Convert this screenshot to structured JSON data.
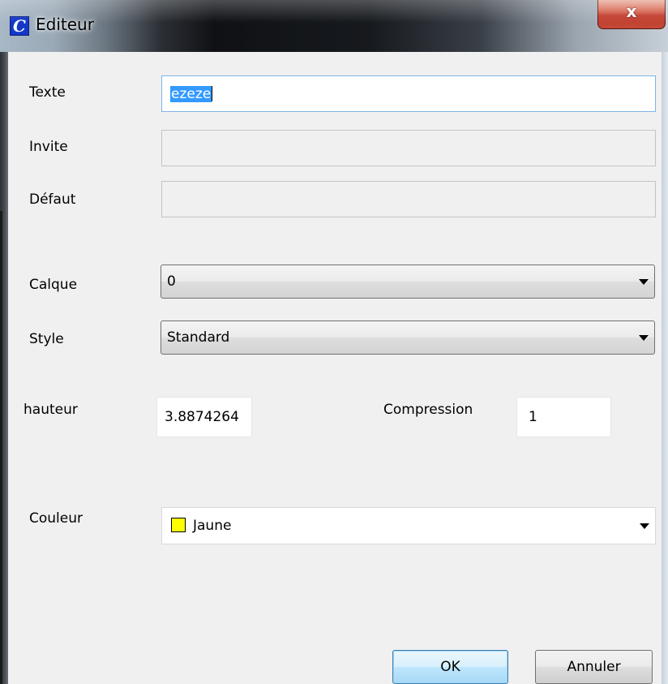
{
  "window": {
    "title": "Editeur",
    "app_icon_glyph": "C",
    "close_glyph": "x"
  },
  "form": {
    "texte": {
      "label": "Texte",
      "value": "ezeze"
    },
    "invite": {
      "label": "Invite",
      "value": ""
    },
    "defaut": {
      "label": "Défaut",
      "value": ""
    },
    "calque": {
      "label": "Calque",
      "value": "0"
    },
    "style": {
      "label": "Style",
      "value": "Standard"
    },
    "hauteur": {
      "label": "hauteur",
      "value": "3.8874264"
    },
    "compression": {
      "label": "Compression",
      "value": "1"
    },
    "couleur": {
      "label": "Couleur",
      "value": "Jaune",
      "swatch_color": "#ffff00"
    }
  },
  "buttons": {
    "ok": "OK",
    "annuler": "Annuler"
  },
  "icons": {
    "app": "app-logo-icon",
    "close": "close-icon",
    "dropdown": "chevron-down-icon"
  }
}
